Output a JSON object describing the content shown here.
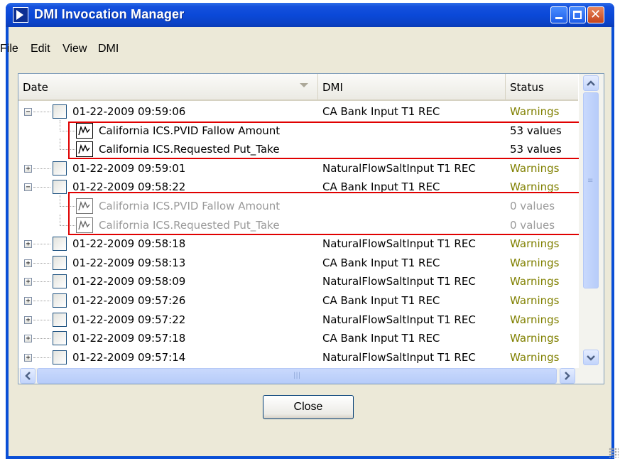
{
  "window": {
    "title": "DMI Invocation Manager"
  },
  "menu": [
    "File",
    "Edit",
    "View",
    "DMI"
  ],
  "columns": {
    "date": "Date",
    "dmi": "DMI",
    "status": "Status"
  },
  "rows": [
    {
      "kind": "parent",
      "expanded": true,
      "date": "01-22-2009 09:59:06",
      "dmi": "CA Bank Input T1 REC",
      "status": "Warnings"
    },
    {
      "kind": "child",
      "name": "California ICS.PVID Fallow Amount",
      "status": "53 values",
      "dim": false
    },
    {
      "kind": "child",
      "name": "California ICS.Requested Put_Take",
      "status": "53 values",
      "dim": false
    },
    {
      "kind": "parent",
      "expanded": false,
      "date": "01-22-2009 09:59:01",
      "dmi": "NaturalFlowSaltInput T1 REC",
      "status": "Warnings"
    },
    {
      "kind": "parent",
      "expanded": true,
      "date": "01-22-2009 09:58:22",
      "dmi": "CA Bank Input T1 REC",
      "status": "Warnings"
    },
    {
      "kind": "child",
      "name": "California ICS.PVID Fallow Amount",
      "status": "0 values",
      "dim": true
    },
    {
      "kind": "child",
      "name": "California ICS.Requested Put_Take",
      "status": "0 values",
      "dim": true
    },
    {
      "kind": "parent",
      "expanded": false,
      "date": "01-22-2009 09:58:18",
      "dmi": "NaturalFlowSaltInput T1 REC",
      "status": "Warnings"
    },
    {
      "kind": "parent",
      "expanded": false,
      "date": "01-22-2009 09:58:13",
      "dmi": "CA Bank Input T1 REC",
      "status": "Warnings"
    },
    {
      "kind": "parent",
      "expanded": false,
      "date": "01-22-2009 09:58:09",
      "dmi": "NaturalFlowSaltInput T1 REC",
      "status": "Warnings"
    },
    {
      "kind": "parent",
      "expanded": false,
      "date": "01-22-2009 09:57:26",
      "dmi": "CA Bank Input T1 REC",
      "status": "Warnings"
    },
    {
      "kind": "parent",
      "expanded": false,
      "date": "01-22-2009 09:57:22",
      "dmi": "NaturalFlowSaltInput T1 REC",
      "status": "Warnings"
    },
    {
      "kind": "parent",
      "expanded": false,
      "date": "01-22-2009 09:57:18",
      "dmi": "CA Bank Input T1 REC",
      "status": "Warnings"
    },
    {
      "kind": "parent",
      "expanded": false,
      "date": "01-22-2009 09:57:14",
      "dmi": "NaturalFlowSaltInput T1 REC",
      "status": "Warnings"
    }
  ],
  "buttons": {
    "close": "Close"
  },
  "icons": {
    "app": "riverware-app-icon",
    "minimize": "minimize-icon",
    "maximize": "maximize-icon",
    "close": "close-icon",
    "series": "series-slot-icon",
    "sort": "sort-descending-icon"
  },
  "colors": {
    "warnings": "#808000",
    "highlight": "#e00000",
    "titlebar": "#0b49d8"
  }
}
